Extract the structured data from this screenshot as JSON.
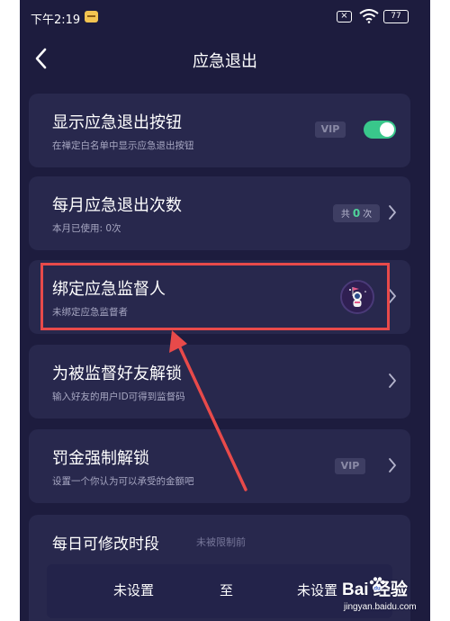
{
  "status_bar": {
    "time": "下午2:19",
    "battery": "77",
    "sim_icon": "no-sim-icon",
    "wifi_icon": "wifi-icon"
  },
  "header": {
    "title": "应急退出",
    "back_icon": "chevron-left-icon"
  },
  "cards": {
    "show_button": {
      "title": "显示应急退出按钮",
      "subtitle": "在禅定白名单中显示应急退出按钮",
      "vip": "VIP",
      "toggle_on": true
    },
    "monthly": {
      "title": "每月应急退出次数",
      "subtitle": "本月已使用: 0次",
      "pill_prefix": "共",
      "pill_count": "0",
      "pill_suffix": "次"
    },
    "supervisor": {
      "title": "绑定应急监督人",
      "subtitle": "未绑定应急监督者"
    },
    "unlock_friend": {
      "title": "为被监督好友解锁",
      "subtitle": "输入好友的用户ID可得到监督码"
    },
    "penalty": {
      "title": "罚金强制解锁",
      "subtitle": "设置一个你认为可以承受的金额吧",
      "vip": "VIP"
    }
  },
  "time_panel": {
    "title": "每日可修改时段",
    "note": "未被限制前",
    "start": "未设置",
    "to": "至",
    "end": "未设置"
  },
  "watermark": {
    "logo": "Bai  经验",
    "url": "jingyan.baidu.com"
  },
  "colors": {
    "background": "#1d1c3e",
    "card": "#28284d",
    "toggle_on": "#39c78b",
    "highlight": "#e84a4a"
  }
}
